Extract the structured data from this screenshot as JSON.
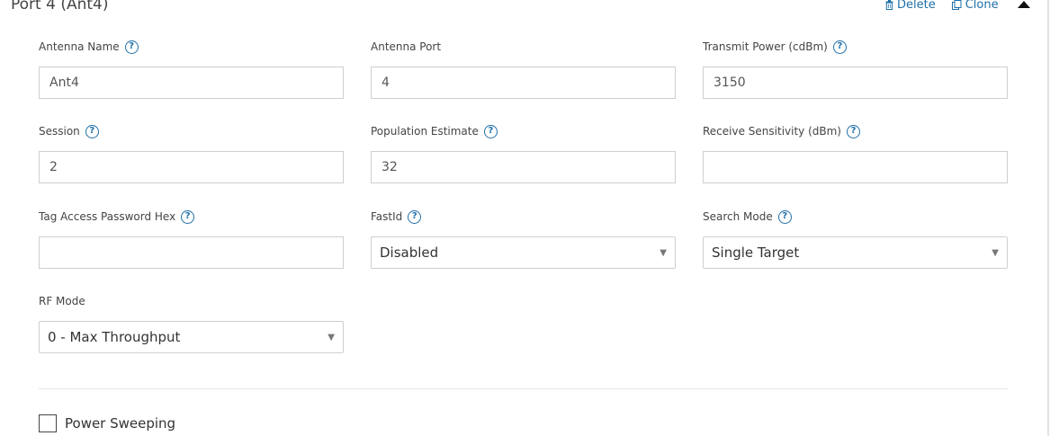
{
  "panel": {
    "title": "Port 4 (Ant4)"
  },
  "actions": {
    "delete_label": "Delete",
    "clone_label": "Clone"
  },
  "fields": {
    "antenna_name": {
      "label": "Antenna Name",
      "value": "Ant4"
    },
    "antenna_port": {
      "label": "Antenna Port",
      "value": "4"
    },
    "transmit_power": {
      "label": "Transmit Power (cdBm)",
      "value": "3150"
    },
    "session": {
      "label": "Session",
      "value": "2"
    },
    "population_estimate": {
      "label": "Population Estimate",
      "value": "32"
    },
    "receive_sensitivity": {
      "label": "Receive Sensitivity (dBm)",
      "value": ""
    },
    "tag_access_password": {
      "label": "Tag Access Password Hex",
      "value": ""
    },
    "fastid": {
      "label": "FastId",
      "selected": "Disabled"
    },
    "search_mode": {
      "label": "Search Mode",
      "selected": "Single Target"
    },
    "rf_mode": {
      "label": "RF Mode",
      "selected": "0 - Max Throughput"
    }
  },
  "power_sweeping": {
    "label": "Power Sweeping",
    "checked": false
  },
  "icons": {
    "help": "?",
    "dropdown_arrow": "▼"
  },
  "colors": {
    "accent": "#1f6fa8"
  }
}
